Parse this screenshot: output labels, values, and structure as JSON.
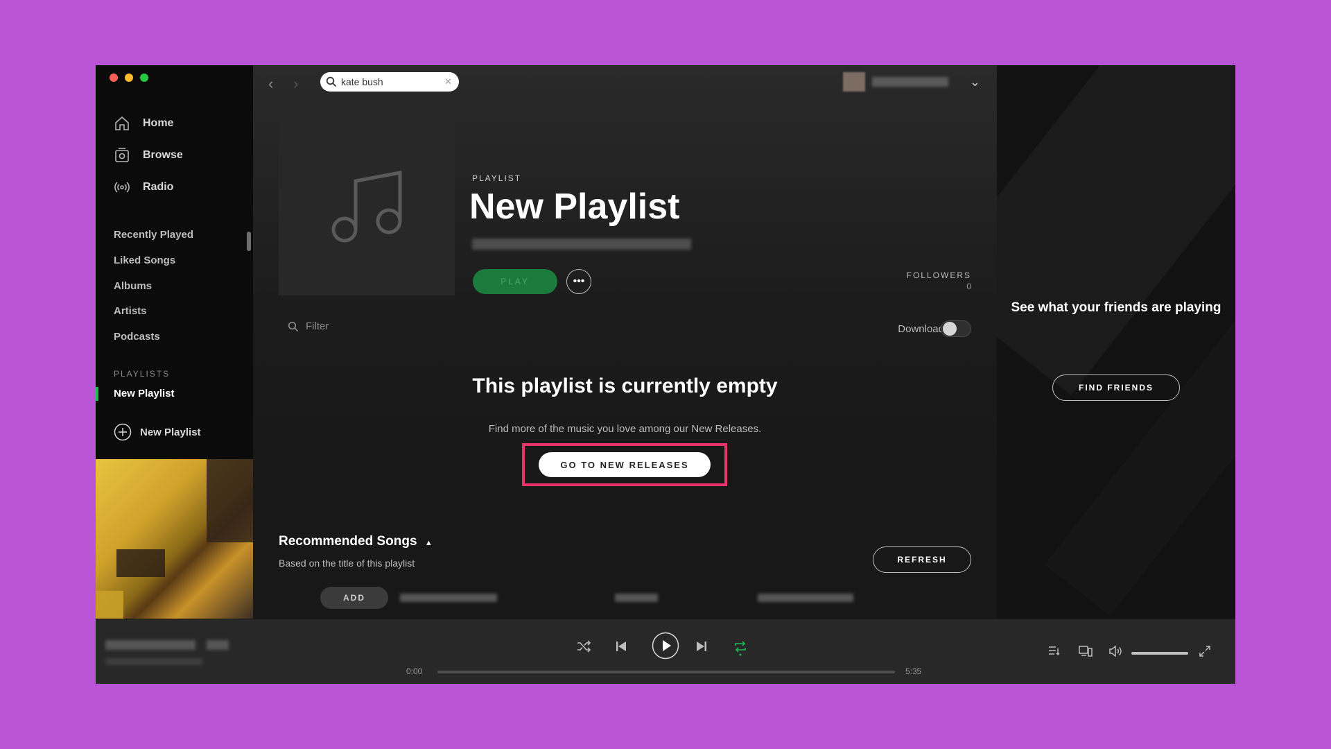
{
  "search": {
    "query": "kate bush"
  },
  "sidebar": {
    "nav": [
      {
        "label": "Home"
      },
      {
        "label": "Browse"
      },
      {
        "label": "Radio"
      }
    ],
    "library": [
      {
        "label": "Recently Played"
      },
      {
        "label": "Liked Songs"
      },
      {
        "label": "Albums"
      },
      {
        "label": "Artists"
      },
      {
        "label": "Podcasts"
      }
    ],
    "playlists_label": "PLAYLISTS",
    "playlists": [
      {
        "label": "New Playlist"
      }
    ],
    "new_playlist_label": "New Playlist"
  },
  "playlist": {
    "type_label": "PLAYLIST",
    "title": "New Playlist",
    "play_label": "PLAY",
    "followers_label": "FOLLOWERS",
    "followers_count": "0"
  },
  "filter": {
    "placeholder": "Filter"
  },
  "download": {
    "label": "Download",
    "enabled": false
  },
  "empty_state": {
    "title": "This playlist is currently empty",
    "description": "Find more of the music you love among our New Releases.",
    "button_label": "GO TO NEW RELEASES"
  },
  "recommended": {
    "title": "Recommended Songs",
    "subtitle": "Based on the title of this playlist",
    "refresh_label": "REFRESH",
    "add_label": "ADD"
  },
  "friends": {
    "text": "See what your friends are playing",
    "button_label": "FIND FRIENDS"
  },
  "player": {
    "elapsed": "0:00",
    "duration": "5:35",
    "progress": 0,
    "volume": 1.0
  },
  "colors": {
    "accent": "#1db954",
    "highlight": "#e8336b",
    "background": "#b955d4"
  }
}
